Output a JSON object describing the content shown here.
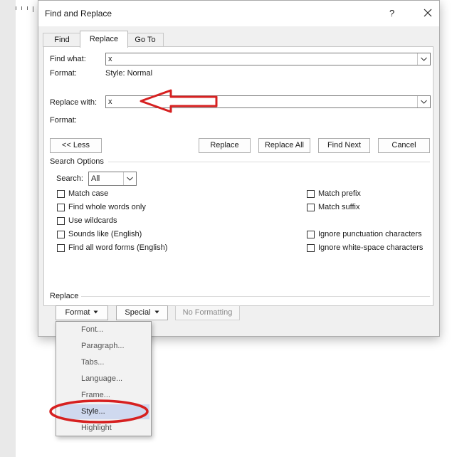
{
  "dialog": {
    "title": "Find and Replace",
    "help_label": "?",
    "tabs": [
      {
        "label": "Find"
      },
      {
        "label": "Replace"
      },
      {
        "label": "Go To"
      }
    ]
  },
  "find": {
    "label": "Find what:",
    "value": "x",
    "format_label": "Format:",
    "format_value": "Style: Normal"
  },
  "replace": {
    "label": "Replace with:",
    "value": "x",
    "format_label": "Format:"
  },
  "buttons": {
    "less": "<< Less",
    "replace": "Replace",
    "replace_all": "Replace All",
    "find_next": "Find Next",
    "cancel": "Cancel"
  },
  "search_options": {
    "heading": "Search Options",
    "search_label": "Search:",
    "search_value": "All",
    "left": [
      {
        "label": "Match case",
        "checked": false
      },
      {
        "label": "Find whole words only",
        "checked": false
      },
      {
        "label": "Use wildcards",
        "checked": false
      },
      {
        "label": "Sounds like (English)",
        "checked": false
      },
      {
        "label": "Find all word forms (English)",
        "checked": false
      }
    ],
    "right": [
      {
        "label": "Match prefix",
        "checked": false
      },
      {
        "label": "Match suffix",
        "checked": false
      },
      {
        "label": "Ignore punctuation characters",
        "checked": false
      },
      {
        "label": "Ignore white-space characters",
        "checked": false
      }
    ]
  },
  "replace_section": {
    "heading": "Replace",
    "format_button": "Format",
    "special_button": "Special",
    "no_formatting_button": "No Formatting"
  },
  "format_menu": {
    "items": [
      "Font...",
      "Paragraph...",
      "Tabs...",
      "Language...",
      "Frame...",
      "Style...",
      "Highlight"
    ],
    "highlighted": "Style..."
  },
  "colors": {
    "annotation": "#d62020",
    "menu_highlight": "#cfd9ef"
  }
}
